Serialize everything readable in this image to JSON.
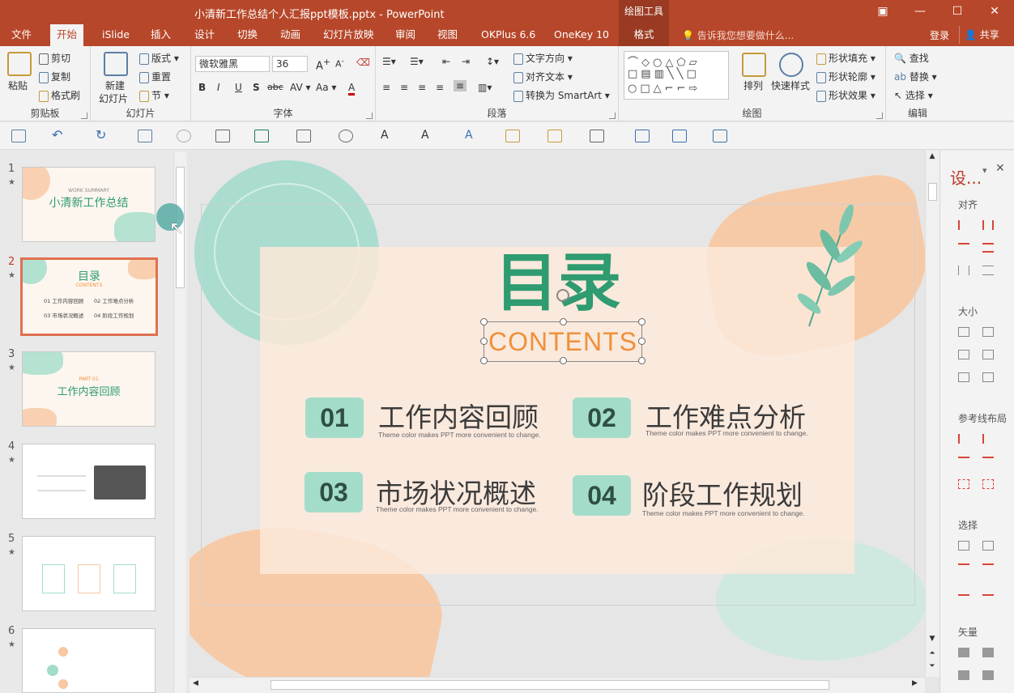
{
  "window": {
    "title": "小清新工作总结个人汇报ppt模板.pptx - PowerPoint",
    "context_tab_group": "绘图工具",
    "controls": [
      "restore-ribbon",
      "minimize",
      "maximize",
      "close"
    ]
  },
  "tabs": [
    "文件",
    "开始",
    "iSlide",
    "插入",
    "设计",
    "切换",
    "动画",
    "幻灯片放映",
    "审阅",
    "视图",
    "OKPlus 6.6",
    "OneKey 10",
    "格式"
  ],
  "active_tab": "开始",
  "tell_me": "告诉我您想要做什么...",
  "login": "登录",
  "share": "共享",
  "ribbon": {
    "clipboard": {
      "label": "剪贴板",
      "paste": "粘贴",
      "cut": "剪切",
      "copy": "复制",
      "format_painter": "格式刷"
    },
    "slides": {
      "label": "幻灯片",
      "new_slide_line1": "新建",
      "new_slide_line2": "幻灯片",
      "layout": "版式",
      "reset": "重置",
      "section": "节"
    },
    "font": {
      "label": "字体",
      "font_name": "微软雅黑",
      "font_size": "36",
      "bold": "B",
      "italic": "I",
      "underline": "U",
      "shadow": "S",
      "strike": "abc",
      "spacing": "AV",
      "case": "Aa",
      "color": "A"
    },
    "paragraph": {
      "label": "段落",
      "text_direction": "文字方向",
      "align_text": "对齐文本",
      "smartart": "转换为 SmartArt"
    },
    "drawing": {
      "label": "绘图",
      "arrange": "排列",
      "quick_styles": "快速样式",
      "shape_fill": "形状填充",
      "shape_outline": "形状轮廓",
      "shape_effects": "形状效果"
    },
    "editing": {
      "label": "编辑",
      "find": "查找",
      "replace": "替换",
      "select": "选择"
    }
  },
  "thumbnails": [
    {
      "num": "1",
      "title": "小清新工作总结",
      "sub": "WORK SUMMARY"
    },
    {
      "num": "2",
      "title": "目录",
      "sub": "CONTENTS",
      "items": [
        "01 工作内容回顾",
        "02 工作难点分析",
        "03 市场状况概述",
        "04 阶段工作规划"
      ]
    },
    {
      "num": "3",
      "title": "工作内容回顾",
      "sub": "PART 01"
    },
    {
      "num": "4",
      "title": "",
      "sub": ""
    },
    {
      "num": "5",
      "title": "",
      "sub": ""
    },
    {
      "num": "6",
      "title": "",
      "sub": ""
    }
  ],
  "selected_thumbnail": "2",
  "slide": {
    "heading": "目录",
    "subheading": "CONTENTS",
    "items": [
      {
        "num": "01",
        "title": "工作内容回顾",
        "desc": "Theme  color makes PPT more convenient to change."
      },
      {
        "num": "02",
        "title": "工作难点分析",
        "desc": "Theme  color makes PPT more convenient to change."
      },
      {
        "num": "03",
        "title": "市场状况概述",
        "desc": "Theme  color makes PPT more convenient to change."
      },
      {
        "num": "04",
        "title": "阶段工作规划",
        "desc": "Theme  color makes PPT more convenient to change."
      }
    ]
  },
  "right_panel": {
    "title": "设...",
    "sections": [
      "对齐",
      "大小",
      "参考线布局",
      "选择",
      "矢量"
    ]
  },
  "colors": {
    "brand": "#b7472a",
    "mint": "#a3ddc9",
    "heading_green": "#2e9b70",
    "contents_orange": "#f0903a",
    "peach": "#f8c7a0"
  }
}
